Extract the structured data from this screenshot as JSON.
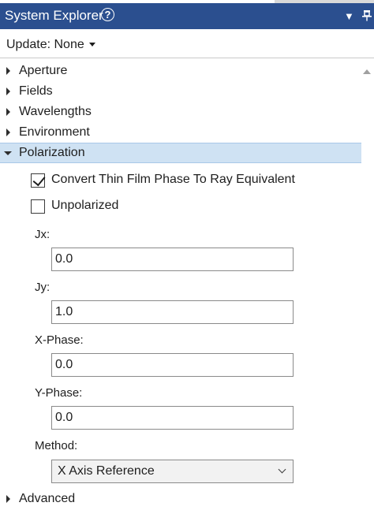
{
  "titlebar": {
    "title": "System Explorer",
    "help_icon": "?",
    "dropdown_icon": "▼",
    "pin_icon": "pin-icon"
  },
  "updatebar": {
    "label": "Update: None"
  },
  "tree": {
    "items": [
      {
        "label": "Aperture",
        "expanded": false
      },
      {
        "label": "Fields",
        "expanded": false
      },
      {
        "label": "Wavelengths",
        "expanded": false
      },
      {
        "label": "Environment",
        "expanded": false
      },
      {
        "label": "Polarization",
        "expanded": true,
        "selected": true
      },
      {
        "label": "Advanced",
        "expanded": false
      }
    ]
  },
  "polarization": {
    "convert_thin_film": {
      "label": "Convert Thin Film Phase To Ray Equivalent",
      "checked": true
    },
    "unpolarized": {
      "label": "Unpolarized",
      "checked": false
    },
    "jx": {
      "label": "Jx:",
      "value": "0.0"
    },
    "jy": {
      "label": "Jy:",
      "value": "1.0"
    },
    "x_phase": {
      "label": "X-Phase:",
      "value": "0.0"
    },
    "y_phase": {
      "label": "Y-Phase:",
      "value": "0.0"
    },
    "method": {
      "label": "Method:",
      "value": "X Axis Reference"
    }
  },
  "colors": {
    "titlebar_bg": "#2b4f8f",
    "selected_row_bg": "#cfe2f3"
  }
}
